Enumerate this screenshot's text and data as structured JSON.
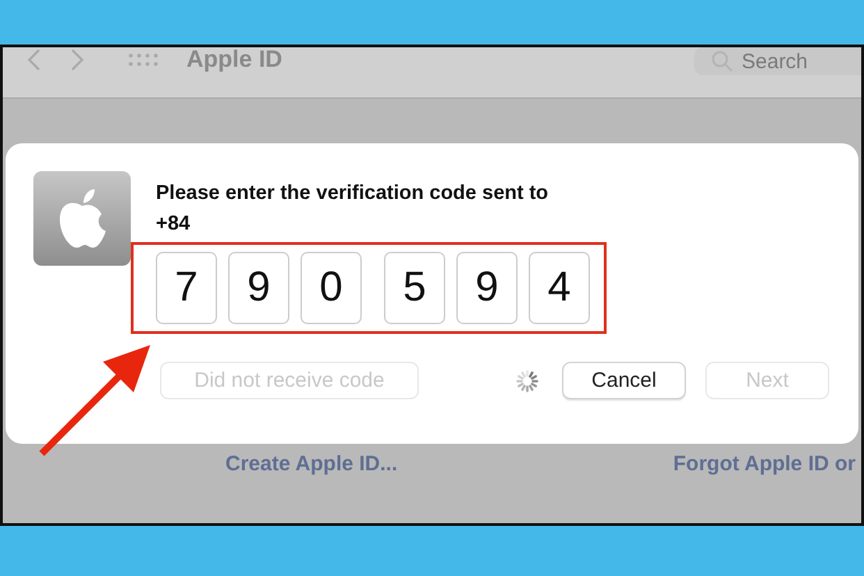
{
  "window": {
    "title": "Apple ID",
    "search": {
      "placeholder": "Search"
    }
  },
  "dialog": {
    "message": "Please enter the verification code sent to",
    "phone": "+84",
    "code_digits": [
      "7",
      "9",
      "0",
      "5",
      "9",
      "4"
    ],
    "loading": true,
    "buttons": [
      {
        "label": "Did not receive code",
        "disabled": true
      },
      {
        "label": "Cancel",
        "disabled": false
      },
      {
        "label": "Next",
        "disabled": true
      }
    ]
  },
  "links": [
    "Create Apple ID...",
    "Forgot Apple ID or"
  ]
}
